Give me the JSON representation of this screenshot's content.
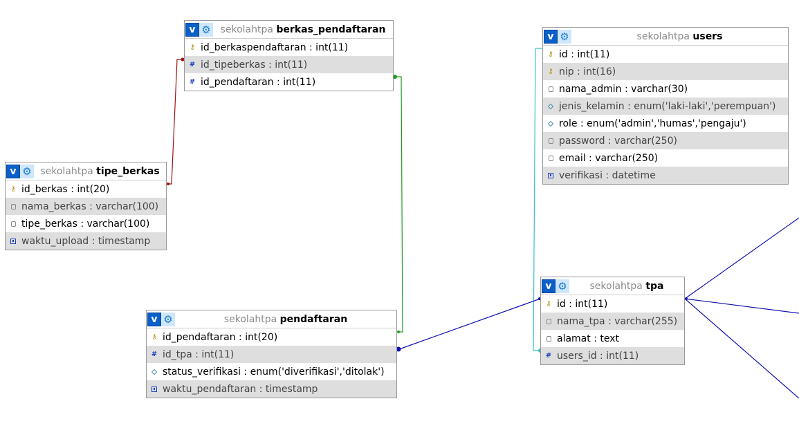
{
  "db_name": "sekolahtpa",
  "header_buttons": {
    "toggle_label": "v",
    "options_icon": "gear-icon"
  },
  "tables": {
    "berkas_pendaftaran": {
      "name": "berkas_pendaftaran",
      "columns": [
        {
          "text": "id_berkaspendaftaran : int(11)",
          "icon": "key-icon"
        },
        {
          "text": "id_tipeberkas : int(11)",
          "icon": "hash-icon"
        },
        {
          "text": "id_pendaftaran : int(11)",
          "icon": "hash-icon"
        }
      ]
    },
    "users": {
      "name": "users",
      "columns": [
        {
          "text": "id : int(11)",
          "icon": "key-icon"
        },
        {
          "text": "nip : int(16)",
          "icon": "key-icon"
        },
        {
          "text": "nama_admin : varchar(30)",
          "icon": "text-field-icon"
        },
        {
          "text": "jenis_kelamin : enum('laki-laki','perempuan')",
          "icon": "enum-icon"
        },
        {
          "text": "role : enum('admin','humas','pengaju')",
          "icon": "enum-icon"
        },
        {
          "text": "password : varchar(250)",
          "icon": "text-field-icon"
        },
        {
          "text": "email : varchar(250)",
          "icon": "text-field-icon"
        },
        {
          "text": "verifikasi : datetime",
          "icon": "datetime-icon"
        }
      ]
    },
    "tipe_berkas": {
      "name": "tipe_berkas",
      "columns": [
        {
          "text": "id_berkas : int(20)",
          "icon": "key-icon"
        },
        {
          "text": "nama_berkas : varchar(100)",
          "icon": "text-field-icon"
        },
        {
          "text": "tipe_berkas : varchar(100)",
          "icon": "text-field-icon"
        },
        {
          "text": "waktu_upload : timestamp",
          "icon": "datetime-icon"
        }
      ]
    },
    "pendaftaran": {
      "name": "pendaftaran",
      "columns": [
        {
          "text": "id_pendaftaran : int(20)",
          "icon": "key-icon"
        },
        {
          "text": "id_tpa : int(11)",
          "icon": "hash-icon"
        },
        {
          "text": "status_verifikasi : enum('diverifikasi','ditolak')",
          "icon": "enum-icon"
        },
        {
          "text": "waktu_pendaftaran : timestamp",
          "icon": "datetime-icon"
        }
      ]
    },
    "tpa": {
      "name": "tpa",
      "columns": [
        {
          "text": "id : int(11)",
          "icon": "key-icon"
        },
        {
          "text": "nama_tpa : varchar(255)",
          "icon": "text-field-icon"
        },
        {
          "text": "alamat : text",
          "icon": "text-field-icon"
        },
        {
          "text": "users_id : int(11)",
          "icon": "hash-icon"
        }
      ]
    }
  },
  "relation_colors": {
    "tipe_berkas_to_berkas": "#a01010",
    "berkas_to_pendaftaran": "#1f9a1f",
    "users_to_tpa": "#35c0c8",
    "tpa_to_pendaftaran": "#1010b0",
    "tpa_offscreen": "#1010b0"
  }
}
